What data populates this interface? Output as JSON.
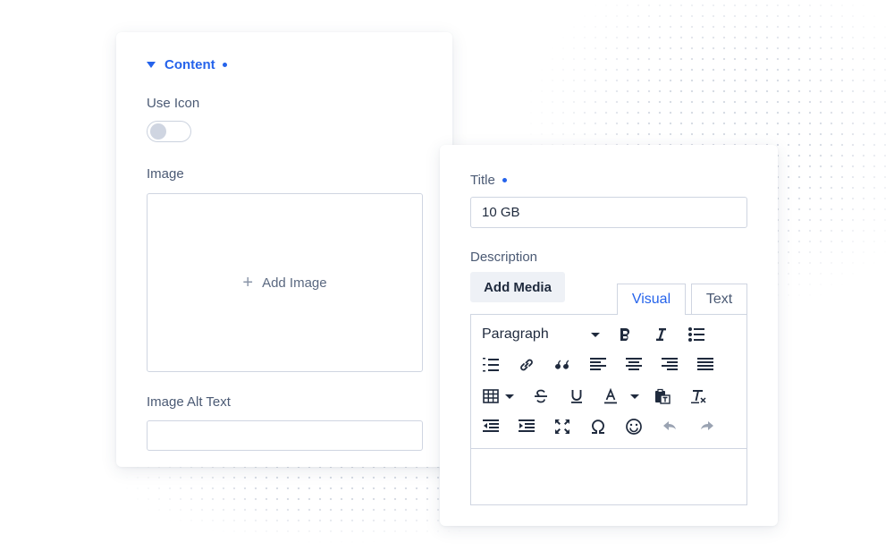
{
  "content_panel": {
    "section_title": "Content",
    "use_icon_label": "Use Icon",
    "use_icon_enabled": false,
    "image_label": "Image",
    "add_image_label": "Add Image",
    "alt_text_label": "Image Alt Text",
    "alt_text_value": ""
  },
  "details_panel": {
    "title_label": "Title",
    "title_value": "10 GB",
    "description_label": "Description",
    "add_media_label": "Add Media",
    "tabs": [
      {
        "label": "Visual",
        "active": true
      },
      {
        "label": "Text",
        "active": false
      }
    ],
    "format_select_value": "Paragraph"
  },
  "colors": {
    "accent": "#2563eb",
    "border": "#cfd5e1",
    "label_text": "#4b5a74"
  }
}
